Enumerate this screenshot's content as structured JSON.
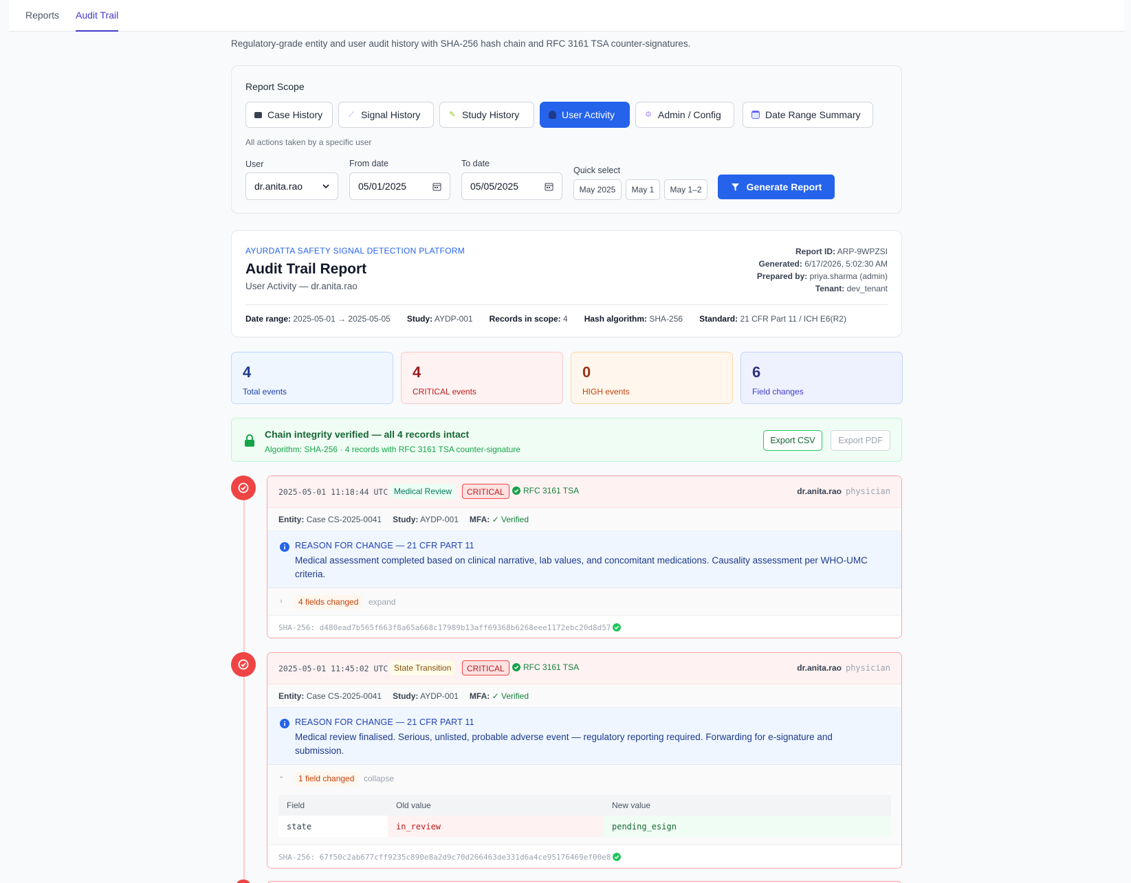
{
  "nav": {
    "tabs": [
      {
        "label": "Reports"
      },
      {
        "label": "Audit Trail"
      }
    ]
  },
  "subtitle": "Regulatory-grade entity and user audit history with SHA-256 hash chain and RFC 3161 TSA counter-signatures.",
  "scope": {
    "title": "Report Scope",
    "buttons": [
      {
        "label": "Case History",
        "icon": "folder-icon"
      },
      {
        "label": "Signal History",
        "icon": "satellite-icon"
      },
      {
        "label": "Study History",
        "icon": "pencil-icon"
      },
      {
        "label": "User Activity",
        "icon": "user-icon"
      },
      {
        "label": "Admin / Config",
        "icon": "gear-icon"
      },
      {
        "label": "Date Range Summary",
        "icon": "calendar-icon"
      }
    ],
    "description": "All actions taken by a specific user",
    "user_label": "User",
    "user_value": "dr.anita.rao",
    "from_label": "From date",
    "from_value": "05/01/2025",
    "to_label": "To date",
    "to_value": "05/05/2025",
    "quick_label": "Quick select",
    "quick": [
      "May 2025",
      "May 1",
      "May 1–2"
    ],
    "generate_label": "Generate Report",
    "accent": "#2563eb"
  },
  "report": {
    "brand": "AYURDATTA SAFETY SIGNAL DETECTION PLATFORM",
    "title": "Audit Trail Report",
    "scope_line": "User Activity — dr.anita.rao",
    "meta": [
      {
        "k": "Report ID:",
        "v": "ARP-9WPZSI"
      },
      {
        "k": "Generated:",
        "v": "6/17/2026, 5:02:30 AM"
      },
      {
        "k": "Prepared by:",
        "v": "priya.sharma (admin)"
      },
      {
        "k": "Tenant:",
        "v": "dev_tenant"
      }
    ],
    "facts": [
      {
        "k": "Date range:",
        "v": "2025-05-01 → 2025-05-05"
      },
      {
        "k": "Study:",
        "v": "AYDP-001"
      },
      {
        "k": "Records in scope:",
        "v": "4"
      },
      {
        "k": "Hash algorithm:",
        "v": "SHA-256"
      },
      {
        "k": "Standard:",
        "v": "21 CFR Part 11 / ICH E6(R2)"
      }
    ]
  },
  "stats": [
    {
      "value": "4",
      "label": "Total events",
      "color": "#1e3a8a"
    },
    {
      "value": "4",
      "label": "CRITICAL events",
      "color": "#991b1b"
    },
    {
      "value": "0",
      "label": "HIGH events",
      "color": "#9a3412"
    },
    {
      "value": "6",
      "label": "Field changes",
      "color": "#312e81"
    }
  ],
  "integrity": {
    "title": "Chain integrity verified — all 4 records intact",
    "detail": "Algorithm: SHA-256 · 4 records with RFC 3161 TSA counter-signature",
    "export_csv": "Export CSV",
    "export_pdf": "Export PDF"
  },
  "events": [
    {
      "timestamp": "2025-05-01 11:18:44 UTC",
      "action": "Medical Review",
      "severity": "CRITICAL",
      "tsa": "RFC 3161 TSA",
      "user": "dr.anita.rao",
      "role": "physician",
      "entity_label": "Entity:",
      "entity": "Case CS-2025-0041",
      "study_label": "Study:",
      "study": "AYDP-001",
      "mfa_label": "MFA:",
      "mfa": "✓ Verified",
      "reason_title": "REASON FOR CHANGE — 21 CFR PART 11",
      "reason": "Medical assessment completed based on clinical narrative, lab values, and concomitant medications. Causality assessment per WHO-UMC criteria.",
      "changes": "4 fields changed",
      "toggle": "expand",
      "hash_label": "SHA-256:",
      "hash": "d480ead7b565f663f8a65a668c17989b13aff69368b6268eee1172ebc20d8d57"
    },
    {
      "timestamp": "2025-05-01 11:45:02 UTC",
      "action": "State Transition",
      "severity": "CRITICAL",
      "tsa": "RFC 3161 TSA",
      "user": "dr.anita.rao",
      "role": "physician",
      "entity_label": "Entity:",
      "entity": "Case CS-2025-0041",
      "study_label": "Study:",
      "study": "AYDP-001",
      "mfa_label": "MFA:",
      "mfa": "✓ Verified",
      "reason_title": "REASON FOR CHANGE — 21 CFR PART 11",
      "reason": "Medical review finalised. Serious, unlisted, probable adverse event — regulatory reporting required. Forwarding for e-signature and submission.",
      "changes": "1 field changed",
      "toggle": "collapse",
      "diff_headers": [
        "Field",
        "Old value",
        "New value"
      ],
      "diff": [
        {
          "field": "state",
          "old": "in_review",
          "new": "pending_esign"
        }
      ],
      "hash_label": "SHA-256:",
      "hash": "67f50c2ab677cff9235c890e8a2d9c70d266463de331d6a4ce95176469ef00e8"
    }
  ]
}
